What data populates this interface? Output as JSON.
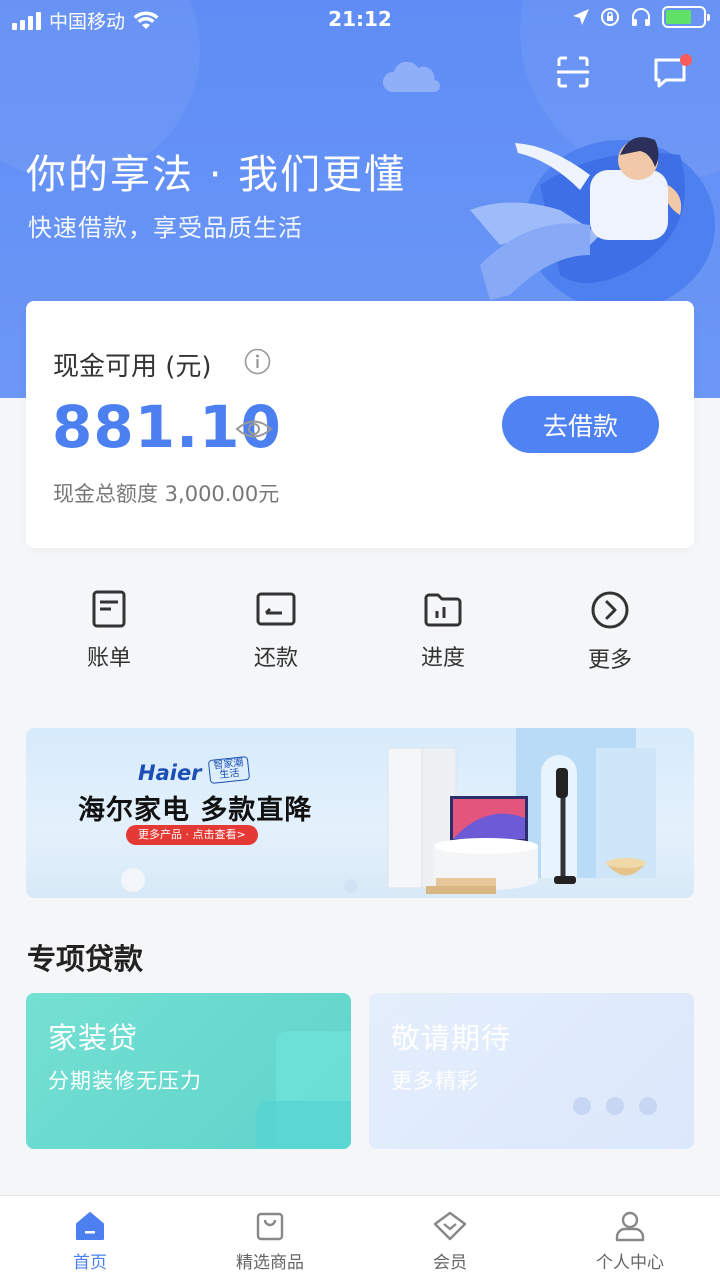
{
  "status_bar": {
    "carrier": "中国移动",
    "time": "21:12"
  },
  "hero": {
    "title": "你的享法 · 我们更懂",
    "subtitle": "快速借款，享受品质生活"
  },
  "balance": {
    "label": "现金可用 (元)",
    "amount": "881.10",
    "total": "现金总额度 3,000.00元",
    "borrow_button": "去借款"
  },
  "quick_actions": [
    {
      "label": "账单",
      "icon": "bill-icon"
    },
    {
      "label": "还款",
      "icon": "repay-icon"
    },
    {
      "label": "进度",
      "icon": "progress-icon"
    },
    {
      "label": "更多",
      "icon": "more-icon"
    }
  ],
  "banner": {
    "brand": "Haier",
    "tag": "智家潮生活",
    "title": "海尔家电  多款直降",
    "cta": "更多产品 · 点击查看>"
  },
  "section": {
    "title": "专项贷款"
  },
  "loans": [
    {
      "title": "家装贷",
      "subtitle": "分期装修无压力"
    },
    {
      "title": "敬请期待",
      "subtitle": "更多精彩"
    }
  ],
  "tabbar": {
    "items": [
      {
        "label": "首页",
        "icon": "home-icon",
        "active": true
      },
      {
        "label": "精选商品",
        "icon": "shop-bag-icon",
        "active": false
      },
      {
        "label": "会员",
        "icon": "member-tag-icon",
        "active": false
      },
      {
        "label": "个人中心",
        "icon": "user-icon",
        "active": false
      }
    ]
  },
  "colors": {
    "primary": "#4c7ff0",
    "hero_bg": "#6590f5",
    "loan_teal": "#5fd3cb",
    "loan_light": "#dbe7fb"
  }
}
